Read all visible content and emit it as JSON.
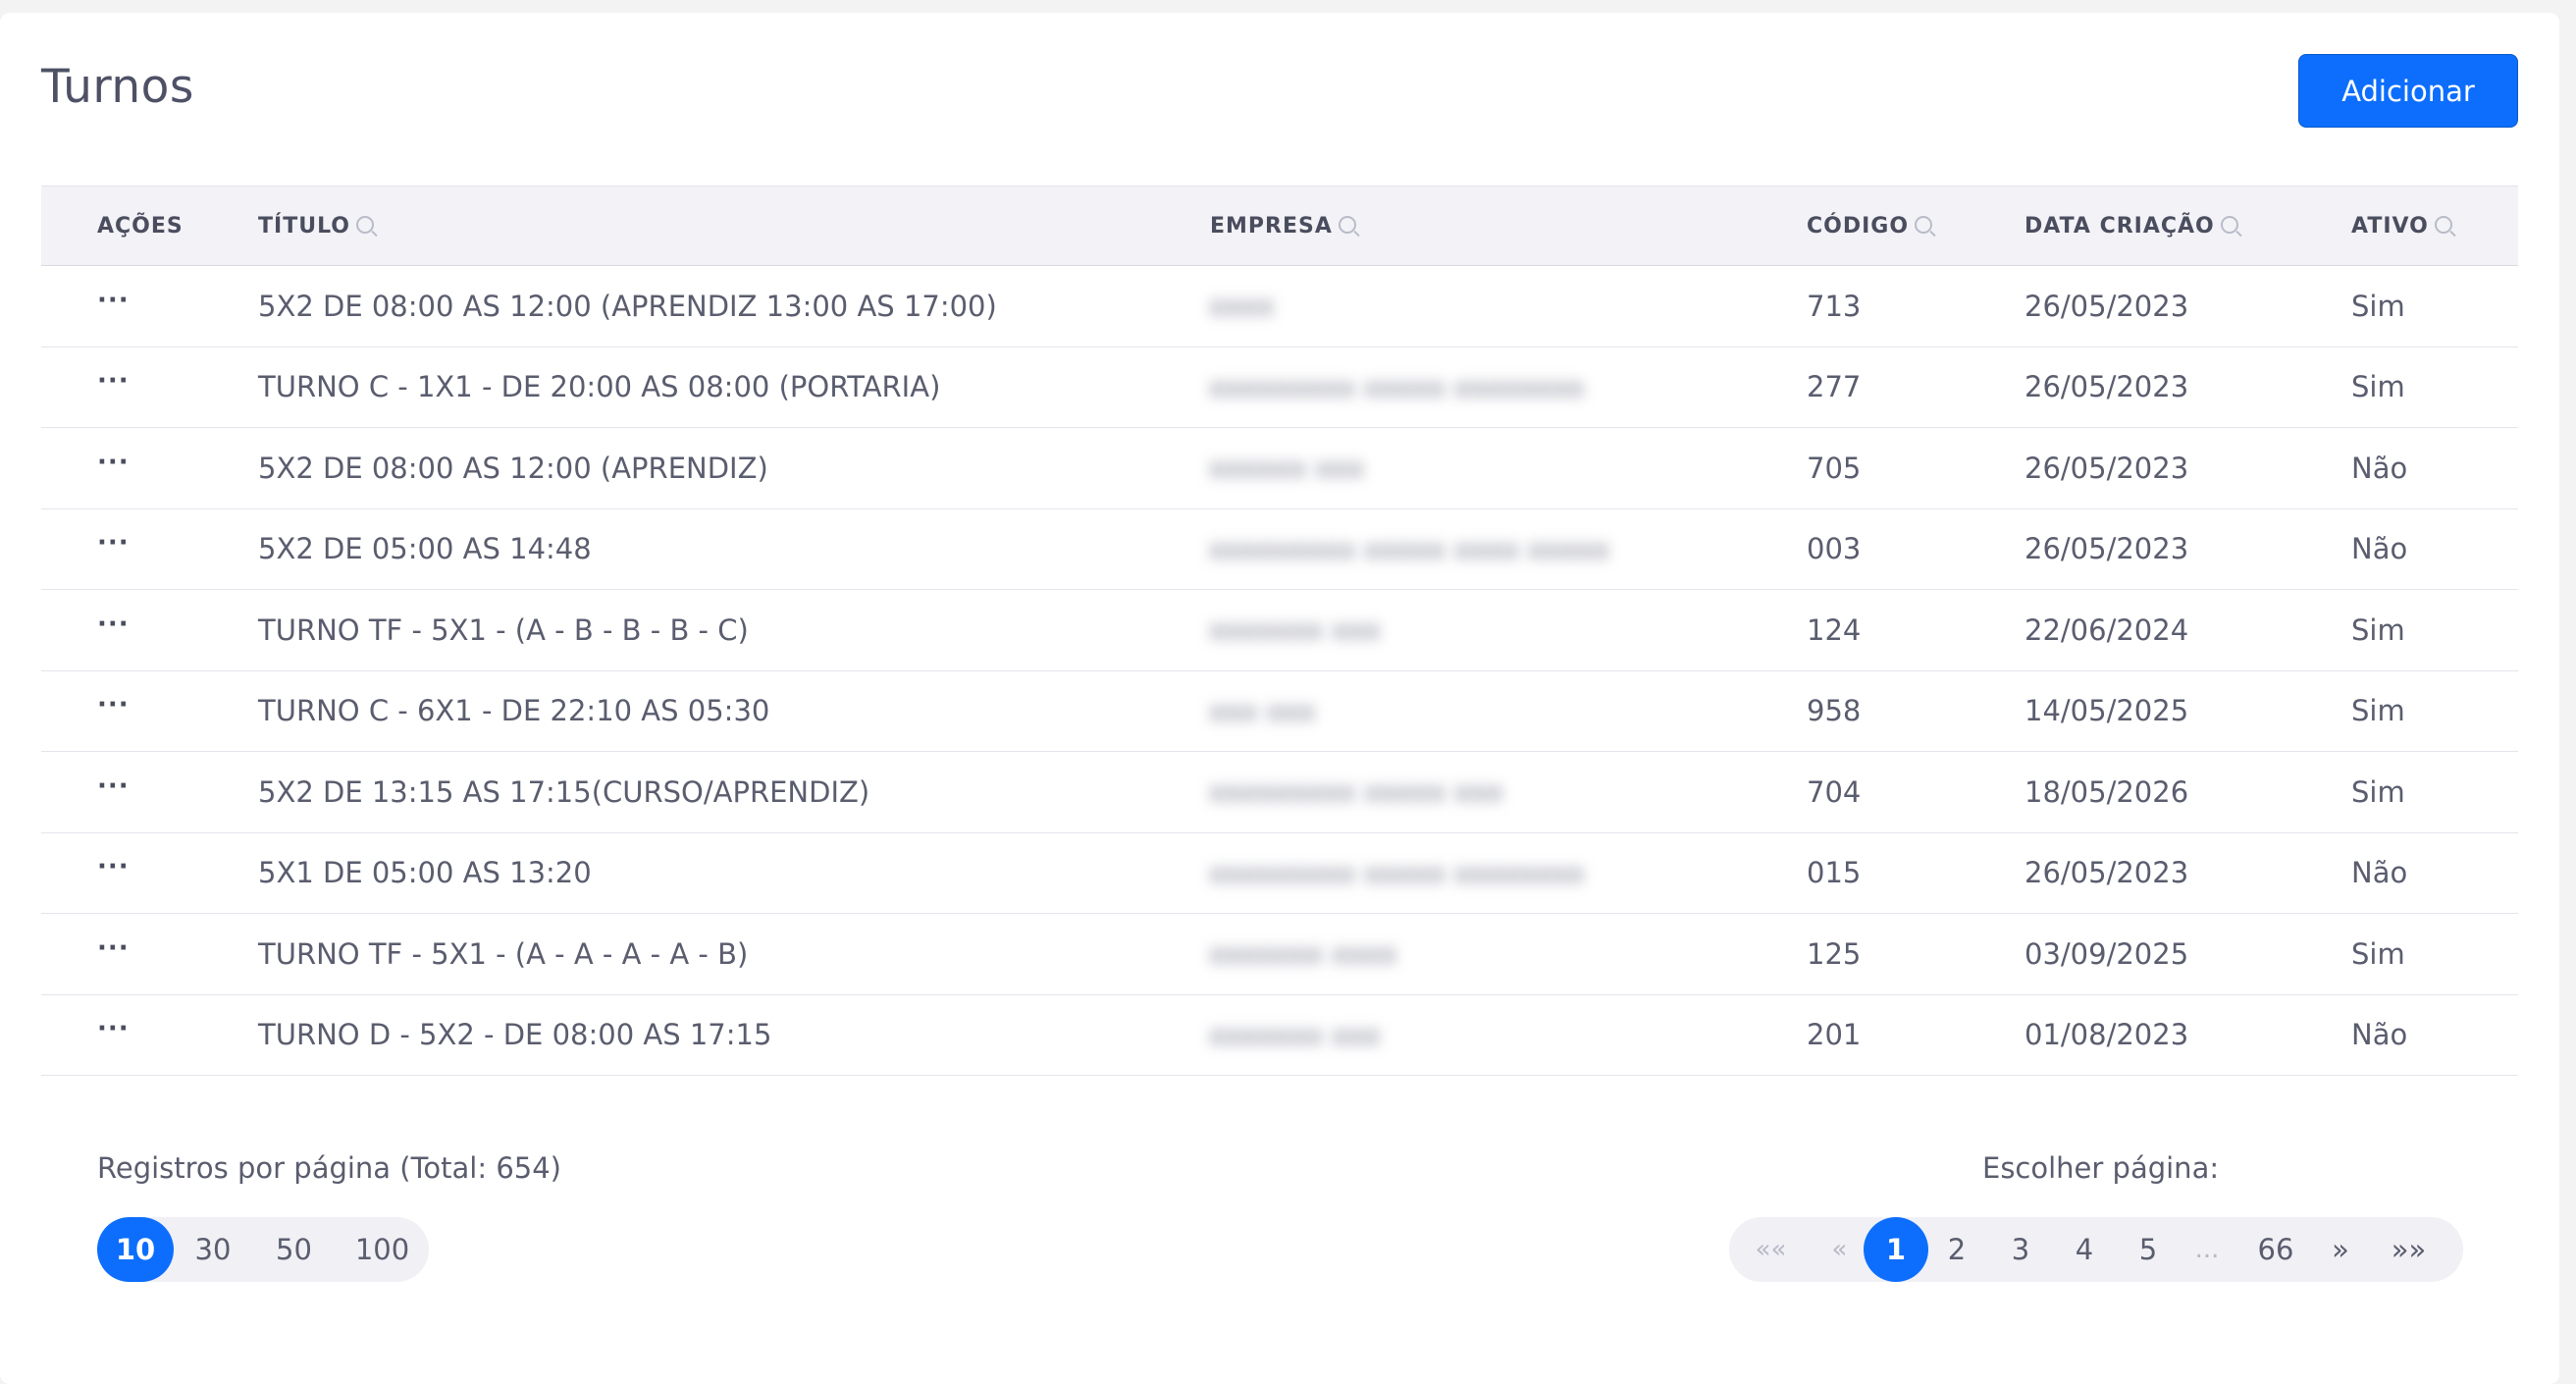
{
  "header": {
    "title": "Turnos",
    "add_button_label": "Adicionar"
  },
  "table": {
    "columns": [
      {
        "key": "acoes",
        "label": "AÇÕES",
        "searchable": false
      },
      {
        "key": "titulo",
        "label": "TÍTULO",
        "searchable": true
      },
      {
        "key": "empresa",
        "label": "EMPRESA",
        "searchable": true
      },
      {
        "key": "codigo",
        "label": "CÓDIGO",
        "searchable": true
      },
      {
        "key": "data",
        "label": "DATA CRIAÇÃO",
        "searchable": true
      },
      {
        "key": "ativo",
        "label": "ATIVO",
        "searchable": true
      }
    ],
    "actions_glyph": "···",
    "rows": [
      {
        "titulo": "5X2 DE 08:00 AS 12:00 (APRENDIZ 13:00 AS 17:00)",
        "empresa": "xxxx",
        "codigo": "713",
        "data": "26/05/2023",
        "ativo": "Sim"
      },
      {
        "titulo": "TURNO C - 1X1 - DE 20:00 AS 08:00 (PORTARIA)",
        "empresa": "xxxxxxxxx xxxxx xxxxxxxx",
        "codigo": "277",
        "data": "26/05/2023",
        "ativo": "Sim"
      },
      {
        "titulo": "5X2 DE 08:00 AS 12:00 (APRENDIZ)",
        "empresa": "xxxxxx xxx",
        "codigo": "705",
        "data": "26/05/2023",
        "ativo": "Não"
      },
      {
        "titulo": "5X2 DE 05:00 AS 14:48",
        "empresa": "xxxxxxxxx xxxxx xxxx xxxxx",
        "codigo": "003",
        "data": "26/05/2023",
        "ativo": "Não"
      },
      {
        "titulo": "TURNO TF - 5X1 - (A - B - B - B - C)",
        "empresa": "xxxxxxx xxx",
        "codigo": "124",
        "data": "22/06/2024",
        "ativo": "Sim"
      },
      {
        "titulo": "TURNO C - 6X1 - DE 22:10 AS 05:30",
        "empresa": "xxx xxx",
        "codigo": "958",
        "data": "14/05/2025",
        "ativo": "Sim"
      },
      {
        "titulo": "5X2 DE 13:15 AS 17:15(CURSO/APRENDIZ)",
        "empresa": "xxxxxxxxx xxxxx xxx",
        "codigo": "704",
        "data": "18/05/2026",
        "ativo": "Sim"
      },
      {
        "titulo": "5X1 DE 05:00 AS 13:20",
        "empresa": "xxxxxxxxx xxxxx xxxxxxxx",
        "codigo": "015",
        "data": "26/05/2023",
        "ativo": "Não"
      },
      {
        "titulo": "TURNO TF - 5X1 - (A - A - A - A - B)",
        "empresa": "xxxxxxx xxxx",
        "codigo": "125",
        "data": "03/09/2025",
        "ativo": "Sim"
      },
      {
        "titulo": "TURNO D - 5X2 - DE 08:00 AS 17:15",
        "empresa": "xxxxxxx xxx",
        "codigo": "201",
        "data": "01/08/2023",
        "ativo": "Não"
      }
    ]
  },
  "footer": {
    "records_label": "Registros por página (Total: 654)",
    "choose_page_label": "Escolher página:",
    "page_sizes": [
      "10",
      "30",
      "50",
      "100"
    ],
    "selected_page_size": "10",
    "pager": {
      "first": "««",
      "prev": "«",
      "pages": [
        "1",
        "2",
        "3",
        "4",
        "5"
      ],
      "current": "1",
      "ellipsis": "...",
      "last_page": "66",
      "next": "»",
      "last": "»»"
    }
  },
  "colors": {
    "accent": "#0d6efd",
    "header_bg": "#f2f2f7",
    "text": "#5a5d6e"
  }
}
